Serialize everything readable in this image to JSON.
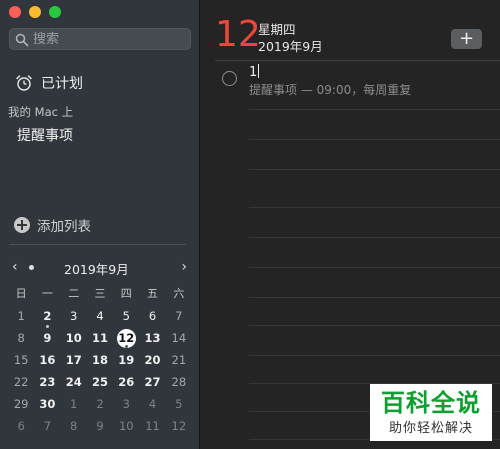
{
  "window": {
    "buttons": [
      "close",
      "minimize",
      "maximize"
    ]
  },
  "sidebar": {
    "search": {
      "placeholder": "搜索",
      "value": ""
    },
    "scheduled": {
      "label": "已计划",
      "icon": "alarm-clock-icon"
    },
    "section_label": "我的 Mac 上",
    "lists": [
      {
        "label": "提醒事项"
      }
    ],
    "add_list_label": "添加列表"
  },
  "calendar": {
    "title": "2019年9月",
    "weekdays": [
      "日",
      "一",
      "二",
      "三",
      "四",
      "五",
      "六"
    ],
    "weeks": [
      [
        "1",
        "2",
        "3",
        "4",
        "5",
        "6",
        "7"
      ],
      [
        "8",
        "9",
        "10",
        "11",
        "12",
        "13",
        "14"
      ],
      [
        "15",
        "16",
        "17",
        "18",
        "19",
        "20",
        "21"
      ],
      [
        "22",
        "23",
        "24",
        "25",
        "26",
        "27",
        "28"
      ],
      [
        "29",
        "30",
        "1",
        "2",
        "3",
        "4",
        "5"
      ],
      [
        "6",
        "7",
        "8",
        "9",
        "10",
        "11",
        "12"
      ]
    ],
    "selected_day": "12"
  },
  "main": {
    "day": "12",
    "weekday": "星期四",
    "month": "2019年9月",
    "add_button": "+",
    "tasks": [
      {
        "title": "1",
        "subtitle": "提醒事项 — 09:00，每周重复",
        "completed": false
      }
    ]
  },
  "watermark": {
    "top": "百科全说",
    "bottom": "助你轻松解决"
  },
  "colors": {
    "accent_red": "#f0463a",
    "sidebar_bg": "#30363c",
    "main_bg": "#242424",
    "watermark_green": "#0e9f2e"
  }
}
